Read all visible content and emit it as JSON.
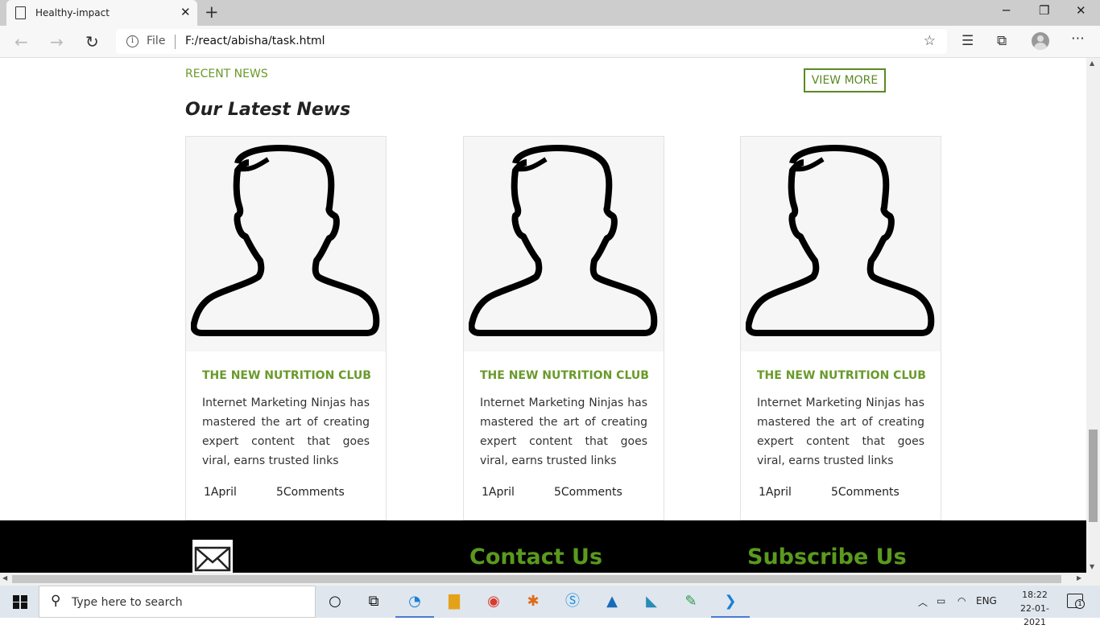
{
  "browser": {
    "tab_title": "Healthy-impact",
    "address_prefix": "File",
    "url": "F:/react/abisha/task.html"
  },
  "page": {
    "recent_news_label": "RECENT NEWS",
    "view_more_label": "VIEW MORE",
    "section_title": "Our Latest News",
    "cards": [
      {
        "title": "THE NEW NUTRITION CLUB",
        "description": "Internet Marketing Ninjas has mastered the art of creating expert content that goes viral, earns trusted links",
        "date": "1April",
        "comments": "5Comments"
      },
      {
        "title": "THE NEW NUTRITION CLUB",
        "description": "Internet Marketing Ninjas has mastered the art of creating expert content that goes viral, earns trusted links",
        "date": "1April",
        "comments": "5Comments"
      },
      {
        "title": "THE NEW NUTRITION CLUB",
        "description": "Internet Marketing Ninjas has mastered the art of creating expert content that goes viral, earns trusted links",
        "date": "1April",
        "comments": "5Comments"
      }
    ],
    "footer": {
      "contact_title": "Contact Us",
      "subscribe_title": "Subscribe Us"
    }
  },
  "taskbar": {
    "search_placeholder": "Type here to search",
    "language": "ENG",
    "time": "18:22",
    "date": "22-01-2021",
    "notification_count": "1"
  },
  "colors": {
    "accent_green": "#6a9a2a",
    "footer_green": "#5a9a1e",
    "footer_bg": "#000000"
  }
}
